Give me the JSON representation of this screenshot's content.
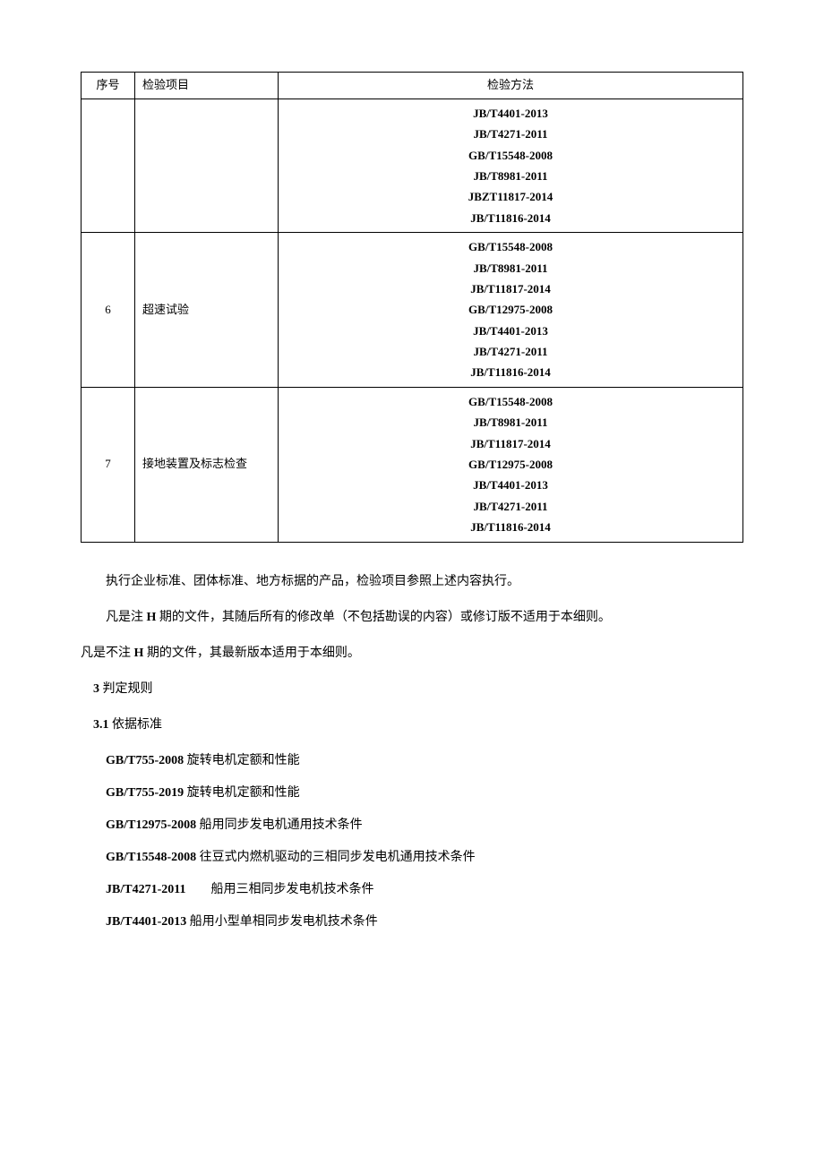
{
  "table": {
    "headers": {
      "seq": "序号",
      "item": "检验项目",
      "method": "检验方法"
    },
    "rows": [
      {
        "seq": "",
        "item": "",
        "methods": [
          "JB/T4401-2013",
          "JB/T4271-2011",
          "GB/T15548-2008",
          "JB/T8981-2011",
          "JBZT11817-2014",
          "JB/T11816-2014"
        ]
      },
      {
        "seq": "6",
        "item": "超速试验",
        "methods": [
          "GB/T15548-2008",
          "JB/T8981-2011",
          "JB/T11817-2014",
          "GB/T12975-2008",
          "JB/T4401-2013",
          "JB/T4271-2011",
          "JB/T11816-2014"
        ]
      },
      {
        "seq": "7",
        "item": "接地装置及标志检查",
        "methods": [
          "GB/T15548-2008",
          "JB/T8981-2011",
          "JB/T11817-2014",
          "GB/T12975-2008",
          "JB/T4401-2013",
          "JB/T4271-2011",
          "JB/T11816-2014"
        ]
      }
    ]
  },
  "paragraphs": {
    "p1": "执行企业标准、团体标准、地方标据的产品，检验项目参照上述内容执行。",
    "p2_prefix": "凡是注",
    "p2_bold": " H ",
    "p2_suffix": "期的文件，其随后所有的修改单（不包括勘误的内容）或修订版不适用于本细则。",
    "p3_prefix": "凡是不注",
    "p3_bold": " H ",
    "p3_suffix": "期的文件，其最新版本适用于本细则。"
  },
  "section3": {
    "title_num": "3",
    "title_text": " 判定规则",
    "sub_num": "3.1",
    "sub_text": " 依据标准"
  },
  "standards": [
    {
      "code": "GB/T755-2008",
      "name": " 旋转电机定额和性能"
    },
    {
      "code": "GB/T755-2019",
      "name": " 旋转电机定额和性能"
    },
    {
      "code": "GB/T12975-2008",
      "name": " 船用同步发电机通用技术条件"
    },
    {
      "code": "GB/T15548-2008",
      "name": " 往豆式内燃机驱动的三相同步发电机通用技术条件"
    },
    {
      "code": "JB/T4271-2011",
      "name": "　　船用三相同步发电机技术条件"
    },
    {
      "code": "JB/T4401-2013",
      "name": " 船用小型单相同步发电机技术条件"
    }
  ]
}
